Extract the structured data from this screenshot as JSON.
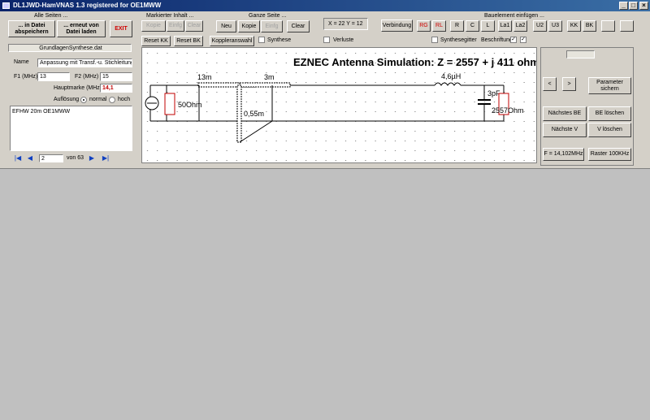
{
  "window": {
    "title": "DL1JWD-HamVNAS 1.3 registered for OE1MWW",
    "controls": [
      "_",
      "□",
      "×"
    ]
  },
  "alle_seiten": {
    "header": "Alle Seiten ...",
    "save": "... in Datei abspeichern",
    "load": "... erneut von Datei laden",
    "exit": "EXIT"
  },
  "file_label": "GrundlagenSynthese.dat",
  "form": {
    "name_label": "Name",
    "name_value": "Anpassung mit Transf.-u. Stichleitung",
    "f1_label": "F1 (MHz)",
    "f1_value": "13",
    "f2_label": "F2 (MHz)",
    "f2_value": "15",
    "hm_label": "Hauptmarke (MHz)",
    "hm_value": "14,1",
    "aufl_label": "Auflösung",
    "normal_label": "normal",
    "hoch_label": "hoch",
    "notes": "EFHW 20m OE1MWW"
  },
  "nav": {
    "page": "2",
    "of": "von 63"
  },
  "markiert": {
    "header": "Markierter Inhalt ...",
    "kopie": "Kopie",
    "einfg": "Einfg",
    "clear": "Clear"
  },
  "ganze": {
    "header": "Ganze Seite ...",
    "neu": "Neu",
    "kopie": "Kopie",
    "einfg": "Einfg",
    "clear": "Clear"
  },
  "coords": "X = 22  Y = 12",
  "verbindung": "Verbindung",
  "bauelement": {
    "header": "Bauelement einfügen ...",
    "items": [
      "RG",
      "RL",
      "R",
      "C",
      "L",
      "La1",
      "La2",
      "U2",
      "U3",
      "KK",
      "BK"
    ]
  },
  "row2": {
    "reset_kk": "Reset KK",
    "reset_bk": "Reset BK",
    "koppler": "Koppleranswahl",
    "synthese": "Synthese",
    "verluste": "Verluste",
    "synthesegitter": "Synthesegitter",
    "beschriftung": "Beschriftung"
  },
  "schematic": {
    "title": "EZNEC Antenna Simulation: Z = 2557 + j 411 ohm",
    "line1": "13m",
    "line2": "3m",
    "stub": "0,55m",
    "source_r": "50Ohm",
    "inductor": "4,6µH",
    "cap": "3pF",
    "load_r": "2557Ohm"
  },
  "right": {
    "prev": "<",
    "next": ">",
    "param": "Parameter sichern",
    "next_be": "Nächstes BE",
    "del_be": "BE löschen",
    "next_v": "Nächste V",
    "del_v": "V löschen",
    "freq": "F = 14,102MHz",
    "raster": "Raster  100KHz"
  }
}
